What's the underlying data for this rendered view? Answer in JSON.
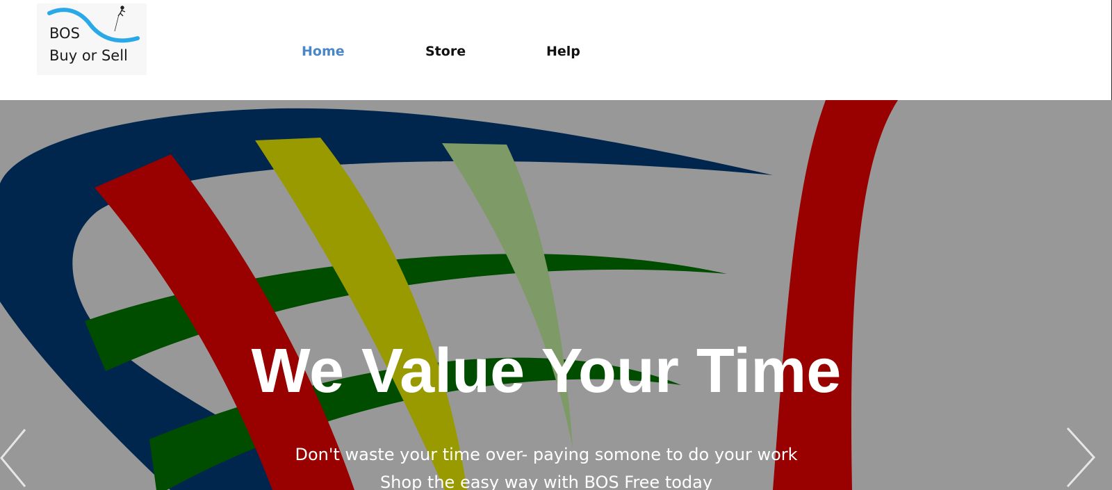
{
  "header": {
    "logo": {
      "line1": "BOS",
      "line2": "Buy or Sell",
      "swoosh_color": "#29a9e8"
    },
    "nav": {
      "items": [
        {
          "label": "Home",
          "active": true
        },
        {
          "label": "Store",
          "active": false
        },
        {
          "label": "Help",
          "active": false
        }
      ],
      "active_color": "#4a86c8",
      "color": "#111111"
    }
  },
  "hero": {
    "title": "We Value Your Time",
    "subtitle_line1": "Don't waste your time over- paying somone to do your work",
    "subtitle_line2": "Shop the easy way with BOS Free today",
    "background_color": "#989898",
    "graphic_colors": {
      "navy": "#00264d",
      "red": "#990000",
      "olive": "#999900",
      "sage": "#7e9a66",
      "green": "#004d00"
    },
    "prev_icon": "chevron-left-icon",
    "next_icon": "chevron-right-icon"
  }
}
